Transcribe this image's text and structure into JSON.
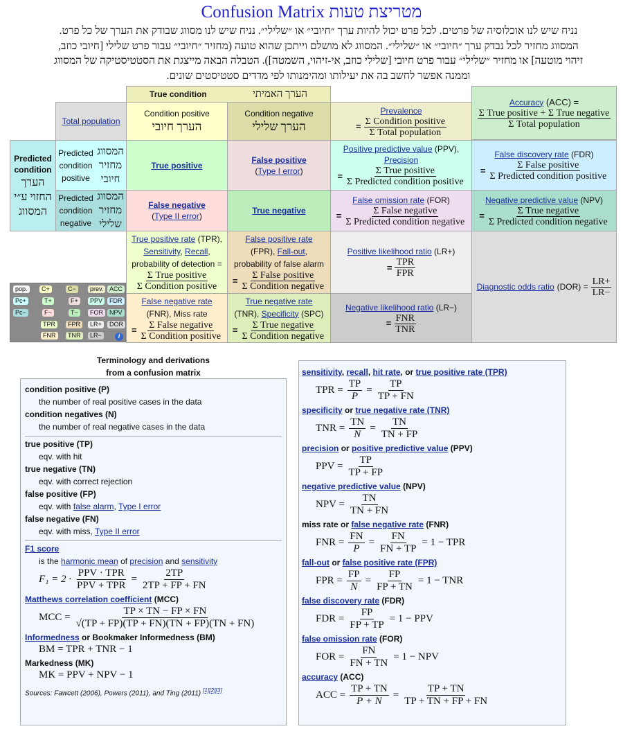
{
  "title": "Confusion Matrix מטריצת טעות",
  "intro": "נניח שיש לנו אוכלוסיה של פרטים. לכל פרט יכול להיות ערך ״חיובי״ או ״שלילי״. נניח שיש לנו מסווג שבודק את הערך של כל פרט. המסווג מחזיר לכל נבדק ערך ״חיובי״ או ״שלילי״. המסווג לא מושלם וייתכן שהוא טועה (מחזיר ״חיובי״ עבור פרט שלילי [חיובי כוזב, זיהוי מוטעה] או מחזיר ״שלילי״ עבור פרט חיובי [שלילי כוזב, אי-זיהוי, השמטה]). הטבלה הבאה מייצגת את הסטטיסטיקה של המסווג וממנה אפשר לחשב בה את יעילותו ומהימנותו לפי מדדים סטטיסטים שונים.",
  "matrix": {
    "true_condition": "True condition",
    "true_condition_he": "הערך האמיתי",
    "total_population": "Total population",
    "cond_pos": "Condition positive",
    "cond_pos_he": "הערך חיובי",
    "cond_neg": "Condition negative",
    "cond_neg_he": "הערך שלילי",
    "prevalence": {
      "link": "Prevalence",
      "num": "Σ Condition positive",
      "den": "Σ Total population"
    },
    "accuracy": {
      "link": "Accuracy",
      "abbr": " (ACC) =",
      "num": "Σ True positive + Σ True negative",
      "den": "Σ Total population"
    },
    "predicted_condition": "Predicted condition",
    "predicted_condition_he": "הערך החזוי ע״י המסווג",
    "pred_pos": "Predicted condition positive",
    "pred_pos_he": "המסווג מחזיר חיובי",
    "pred_neg": "Predicted condition negative",
    "pred_neg_he": "המסווג מחזיר שלילי",
    "tp": "True positive",
    "fp": "False positive",
    "fp_sub": "Type I error",
    "fn": "False negative",
    "fn_sub": "Type II error",
    "tn": "True negative",
    "ppv": {
      "link": "Positive predictive value",
      "abbr": " (PPV),",
      "link2": "Precision",
      "num": "Σ True positive",
      "den": "Σ Predicted condition positive"
    },
    "fdr": {
      "link": "False discovery rate",
      "abbr": " (FDR)",
      "num": "Σ False positive",
      "den": "Σ Predicted condition positive"
    },
    "for": {
      "link": "False omission rate",
      "abbr": " (FOR)",
      "num": "Σ False negative",
      "den": "Σ Predicted condition negative"
    },
    "npv": {
      "link": "Negative predictive value",
      "abbr": " (NPV)",
      "num": "Σ True negative",
      "den": "Σ Predicted condition negative"
    },
    "tpr": {
      "link": "True positive rate",
      "abbr": " (TPR),",
      "link2": "Sensitivity",
      "link3": "Recall",
      "text": "probability of detection =",
      "num": "Σ True positive",
      "den": "Σ Condition positive"
    },
    "fpr": {
      "link": "False positive rate",
      "abbr": "(FPR), ",
      "link2": "Fall-out",
      "text": "probability of false alarm",
      "num": "Σ False positive",
      "den": "Σ Condition negative"
    },
    "fnr": {
      "link": "False negative rate",
      "text": "(FNR), Miss rate",
      "num": "Σ False negative",
      "den": "Σ Condition positive"
    },
    "tnr": {
      "link": "True negative rate",
      "abbr": "(TNR), ",
      "link2": "Specificity",
      "abbr2": " (SPC)",
      "num": "Σ True negative",
      "den": "Σ Condition negative"
    },
    "lrp": {
      "link": "Positive likelihood ratio",
      "abbr": " (LR+)",
      "num": "TPR",
      "den": "FPR"
    },
    "lrn": {
      "link": "Negative likelihood ratio",
      "abbr": " (LR−)",
      "num": "FNR",
      "den": "TNR"
    },
    "dor": {
      "link": "Diagnostic odds ratio",
      "abbr": " (DOR) =",
      "num": "LR+",
      "den": "LR−"
    },
    "eq": "="
  },
  "minimap": {
    "labels": [
      "pop.",
      "C+",
      "C−",
      "prev.",
      "ACC",
      "Pc+",
      "T+",
      "F+",
      "PPV",
      "FDR",
      "Pc−",
      "F−",
      "T−",
      "FOR",
      "NPV",
      "TPR",
      "FPR",
      "LR+",
      "DOR",
      "FNR",
      "TNR",
      "LR−"
    ],
    "info": "i"
  },
  "terminology": {
    "heading1": "Terminology and derivations",
    "heading2": "from a confusion matrix",
    "cp_term": "condition positive (P)",
    "cp_def": "the number of real positive cases in the data",
    "cn_term": "condition negatives (N)",
    "cn_def": "the number of real negative cases in the data",
    "tp_term": "true positive (TP)",
    "tp_def": "eqv. with hit",
    "tn_term": "true negative (TN)",
    "tn_def": "eqv. with correct rejection",
    "fp_term": "false positive (FP)",
    "fp_def_pre": "eqv. with ",
    "fp_link1": "false alarm",
    "fp_link2": "Type I error",
    "fn_term": "false negative (FN)",
    "fn_def_pre": "eqv. with miss, ",
    "fn_link": "Type II error",
    "f1_link": "F1 score",
    "f1_pre": "is the ",
    "f1_l1": "harmonic mean",
    "f1_mid": " of ",
    "f1_l2": "precision",
    "f1_and": " and ",
    "f1_l3": "sensitivity",
    "f1_lhs": "F₁ = 2 ·",
    "f1_n1": "PPV · TPR",
    "f1_d1": "PPV + TPR",
    "f1_n2": "2TP",
    "f1_d2": "2TP + FP + FN",
    "mcc_link": "Matthews correlation coefficient",
    "mcc_abbr": " (MCC)",
    "mcc_lhs": "MCC =",
    "mcc_num": "TP × TN − FP × FN",
    "mcc_den": "√(TP + FP)(TP + FN)(TN + FP)(TN + FN)",
    "bm_link": "Informedness",
    "bm_rest": " or Bookmaker Informedness (BM)",
    "bm_eq": "BM = TPR + TNR − 1",
    "mk_label": "Markedness (MK)",
    "mk_eq": "MK = PPV + NPV − 1",
    "sources": "Sources: Fawcett (2006), Powers (2011), and Ting (2011)",
    "refs": [
      "[1]",
      "[2]",
      "[3]"
    ]
  },
  "derivations": [
    {
      "links": [
        "sensitivity",
        "recall",
        "hit rate",
        "true positive rate (TPR)"
      ],
      "seps": [
        ", ",
        ", ",
        ", or "
      ],
      "abbr": "",
      "lhs": "TPR =",
      "f1n": "TP",
      "f1d": "P",
      "f2n": "TP",
      "f2d": "TP + FN",
      "tail": ""
    },
    {
      "links": [
        "specificity",
        "true negative rate (TNR)"
      ],
      "seps": [
        " or "
      ],
      "abbr": "",
      "lhs": "TNR =",
      "f1n": "TN",
      "f1d": "N",
      "f2n": "TN",
      "f2d": "TN + FP",
      "tail": ""
    },
    {
      "links": [
        "precision",
        "positive predictive value"
      ],
      "seps": [
        " or "
      ],
      "abbr": " (PPV)",
      "lhs": "PPV =",
      "f1n": "TP",
      "f1d": "TP + FP",
      "tail": ""
    },
    {
      "links": [
        "negative predictive value"
      ],
      "seps": [],
      "abbr": " (NPV)",
      "lhs": "NPV =",
      "f1n": "TN",
      "f1d": "TN + FN",
      "tail": ""
    },
    {
      "prefix": "miss rate or ",
      "links": [
        "false negative rate"
      ],
      "seps": [],
      "abbr": " (FNR)",
      "lhs": "FNR =",
      "f1n": "FN",
      "f1d": "P",
      "f2n": "FN",
      "f2d": "FN + TP",
      "tail": "= 1 − TPR"
    },
    {
      "links": [
        "fall-out",
        "false positive rate (FPR)"
      ],
      "seps": [
        " or "
      ],
      "abbr": "",
      "lhs": "FPR =",
      "f1n": "FP",
      "f1d": "N",
      "f2n": "FP",
      "f2d": "FP + TN",
      "tail": "= 1 − TNR"
    },
    {
      "links": [
        "false discovery rate"
      ],
      "seps": [],
      "abbr": " (FDR)",
      "lhs": "FDR =",
      "f1n": "FP",
      "f1d": "FP + TP",
      "tail": "= 1 − PPV"
    },
    {
      "links": [
        "false omission rate"
      ],
      "seps": [],
      "abbr": " (FOR)",
      "lhs": "FOR =",
      "f1n": "FN",
      "f1d": "FN + TN",
      "tail": "= 1 − NPV"
    },
    {
      "links": [
        "accuracy"
      ],
      "seps": [],
      "abbr": " (ACC)",
      "lhs": "ACC =",
      "f1n": "TP + TN",
      "f1d": "P + N",
      "f2n": "TP + TN",
      "f2d": "TP + TN + FP + FN",
      "tail": ""
    }
  ],
  "colors": {
    "title": "#2222cc",
    "link": "#1a2f9e",
    "true_condition_bg": "#eeeebb",
    "cond_pos_bg": "#ffffcc",
    "cond_neg_bg": "#ddddaa",
    "total_pop_bg": "#dddddd",
    "prevalence_bg": "#eeeecc",
    "accuracy_bg": "#cceecc",
    "pred_cond_bg": "#bbeeee",
    "pred_pos_bg": "#ccffff",
    "pred_neg_bg": "#aadddd",
    "tp_bg": "#ccffcc",
    "fp_bg": "#eedddd",
    "fn_bg": "#ffdddd",
    "tn_bg": "#bbeebb",
    "ppv_bg": "#ccffee",
    "fdr_bg": "#cceeff",
    "for_bg": "#eeddee",
    "npv_bg": "#aaddcc",
    "tpr_bg": "#eeffcc",
    "fpr_bg": "#eeddbb",
    "fnr_bg": "#ffeecc",
    "tnr_bg": "#ddeebb",
    "lrp_bg": "#eeeeee",
    "lrn_bg": "#cccccc",
    "dor_bg": "#dddddd",
    "panel_bg": "#f2f6fd"
  }
}
